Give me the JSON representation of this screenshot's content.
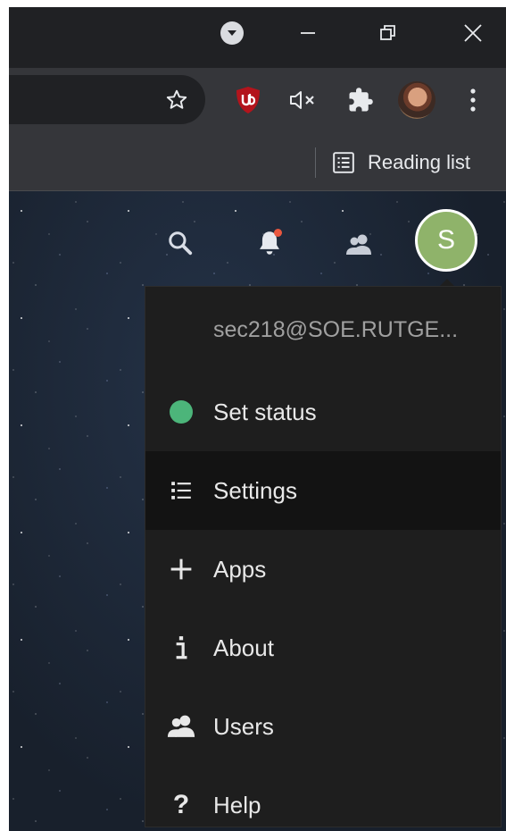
{
  "browser": {
    "reading_list_label": "Reading list"
  },
  "app": {
    "avatar_initial": "S",
    "colors": {
      "status_online": "#4cb57a",
      "avatar_bg": "#8fb36a",
      "notification_dot": "#e9573f"
    }
  },
  "menu": {
    "user_account": "sec218@SOE.RUTGE...",
    "items": [
      {
        "label": "Set status",
        "icon": "status-dot"
      },
      {
        "label": "Settings",
        "icon": "list-icon"
      },
      {
        "label": "Apps",
        "icon": "plus-icon"
      },
      {
        "label": "About",
        "icon": "info-icon"
      },
      {
        "label": "Users",
        "icon": "users-icon"
      },
      {
        "label": "Help",
        "icon": "question-icon"
      }
    ],
    "highlighted_item": "Settings"
  }
}
